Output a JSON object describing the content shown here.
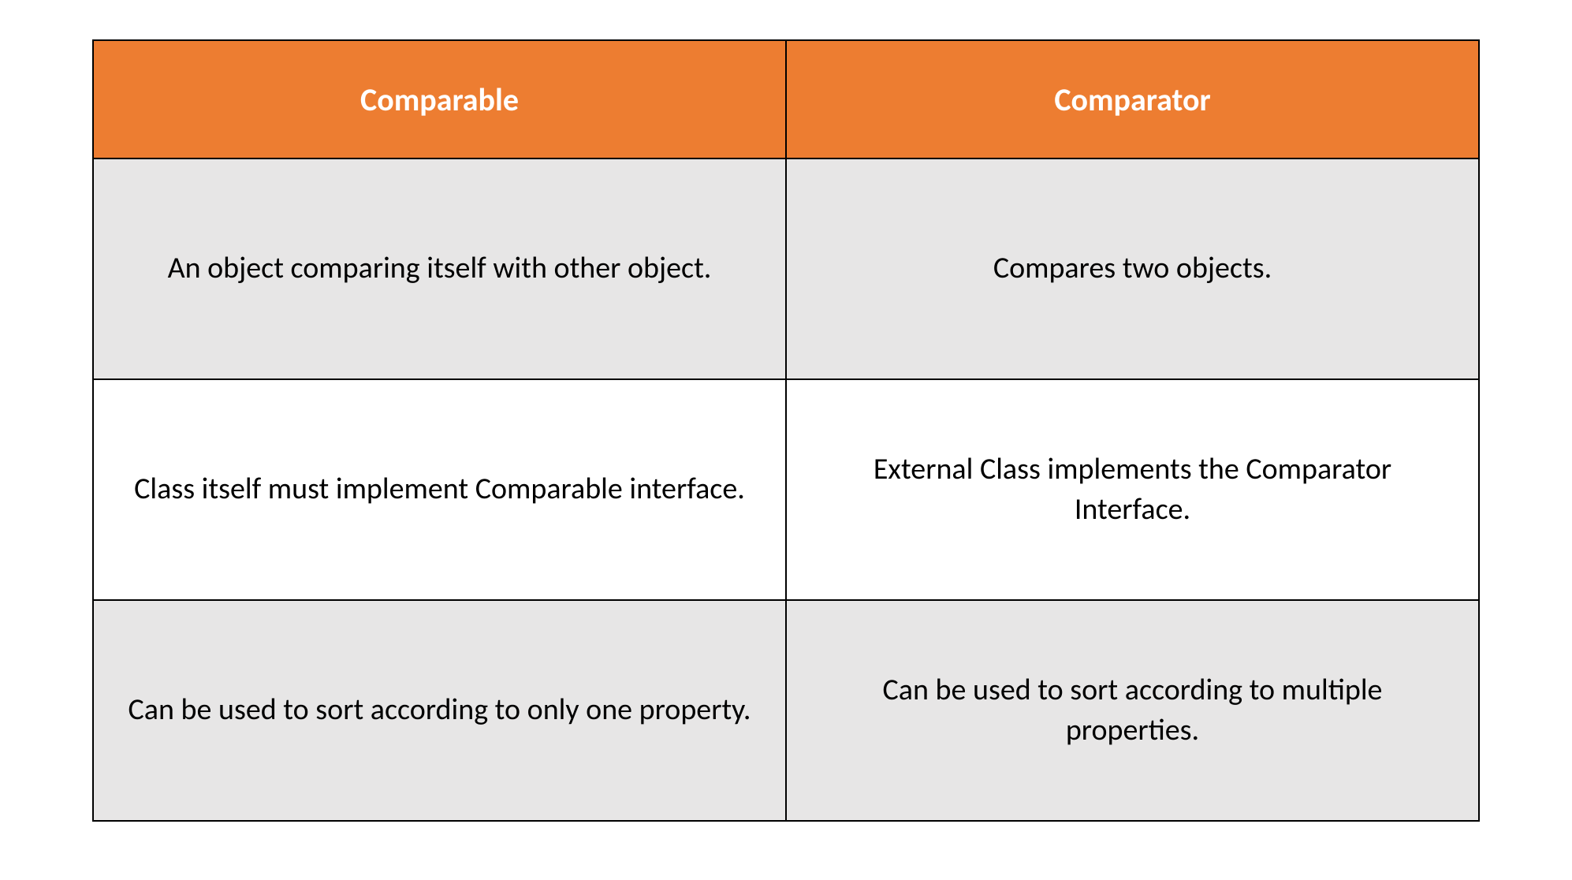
{
  "table": {
    "headers": {
      "col1": "Comparable",
      "col2": "Comparator"
    },
    "rows": [
      {
        "col1": "An object comparing itself with other object.",
        "col2": "Compares two objects."
      },
      {
        "col1": "Class itself must implement Comparable interface.",
        "col2": "External Class implements the Comparator Interface."
      },
      {
        "col1": "Can be used to sort according to only one property.",
        "col2": "Can be used to sort according to multiple properties."
      }
    ]
  }
}
